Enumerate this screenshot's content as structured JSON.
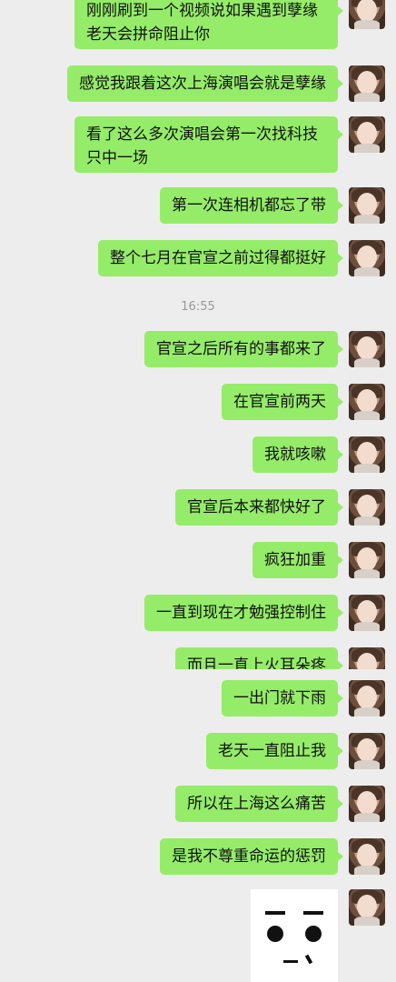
{
  "messages": [
    {
      "text": "刚刚刷到一个视频说如果遇到孽缘老天会拼命阻止你"
    },
    {
      "text": "感觉我跟着这次上海演唱会就是孽缘"
    },
    {
      "text": "看了这么多次演唱会第一次找科技只中一场"
    },
    {
      "text": "第一次连相机都忘了带"
    },
    {
      "text": "整个七月在官宣之前过得都挺好"
    },
    {
      "text": "官宣之后所有的事都来了"
    },
    {
      "text": "在官宣前两天"
    },
    {
      "text": "我就咳嗽"
    },
    {
      "text": "官宣后本来都快好了"
    },
    {
      "text": "疯狂加重"
    },
    {
      "text": "一直到现在才勉强控制住"
    },
    {
      "text": "而且一直上火耳朵疼"
    },
    {
      "text": "一出门就下雨"
    },
    {
      "text": "老天一直阻止我"
    },
    {
      "text": "所以在上海这么痛苦"
    },
    {
      "text": "是我不尊重命运的惩罚"
    }
  ],
  "timestamp": "16:55",
  "colors": {
    "bubble": "#95ec69",
    "background": "#ededed",
    "timestamp": "#999999"
  },
  "icons": {
    "avatar": "user-avatar-photo",
    "sticker": "face-sticker"
  }
}
